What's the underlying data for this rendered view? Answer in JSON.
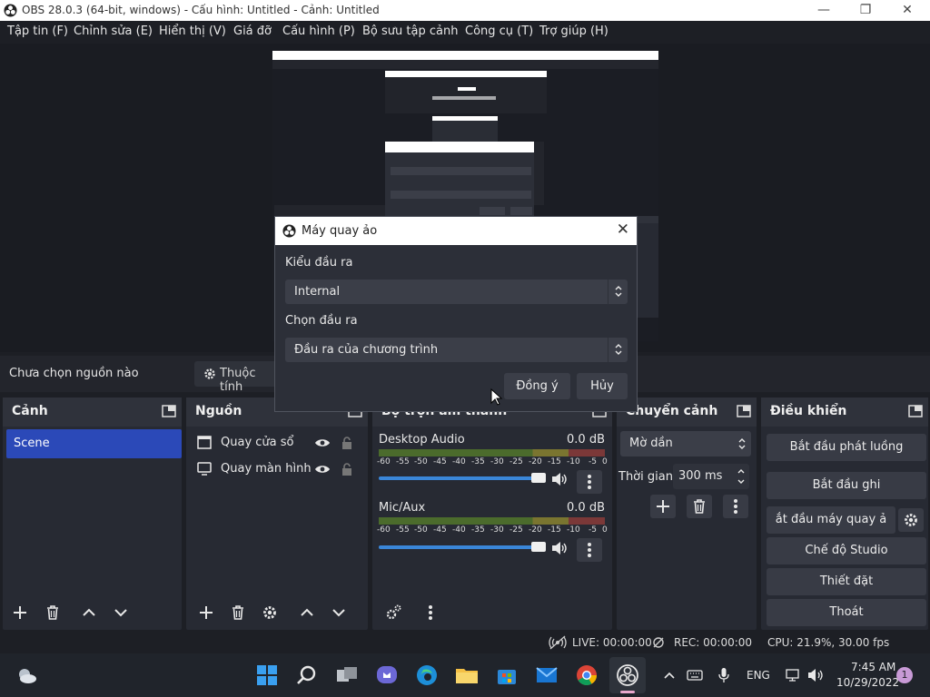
{
  "window": {
    "title": "OBS 28.0.3 (64-bit, windows) - Cấu hình: Untitled - Cảnh: Untitled"
  },
  "menu": [
    "Tập tin (F)",
    "Chỉnh sửa (E)",
    "Hiển thị (V)",
    "Giá đỡ",
    "Cấu hình (P)",
    "Bộ sưu tập cảnh",
    "Công cụ (T)",
    "Trợ giúp (H)"
  ],
  "source_bar": {
    "no_source": "Chưa chọn nguồn nào",
    "properties": "Thuộc tính"
  },
  "scenes": {
    "title": "Cảnh",
    "items": [
      "Scene"
    ]
  },
  "sources": {
    "title": "Nguồn",
    "items": [
      "Quay cửa sổ",
      "Quay màn hình"
    ]
  },
  "mixer": {
    "title": "Bộ trộn âm thanh",
    "channels": [
      {
        "name": "Desktop Audio",
        "level": "0.0 dB"
      },
      {
        "name": "Mic/Aux",
        "level": "0.0 dB"
      }
    ],
    "scale": [
      "-60",
      "-55",
      "-50",
      "-45",
      "-40",
      "-35",
      "-30",
      "-25",
      "-20",
      "-15",
      "-10",
      "-5",
      "0"
    ]
  },
  "transitions": {
    "title": "Chuyển cảnh",
    "type": "Mờ dần",
    "duration_label": "Thời gian",
    "duration": "300 ms"
  },
  "controls": {
    "title": "Điều khiển",
    "start_stream": "Bắt đầu phát luồng",
    "start_record": "Bắt đầu ghi",
    "start_vcam": "ắt đầu máy quay ả",
    "studio_mode": "Chế độ Studio",
    "settings": "Thiết đặt",
    "exit": "Thoát"
  },
  "status": {
    "live": "LIVE: 00:00:00",
    "rec": "REC: 00:00:00",
    "cpu": "CPU: 21.9%, 30.00 fps"
  },
  "dialog": {
    "title": "Máy quay ảo",
    "output_type_label": "Kiểu đầu ra",
    "output_type": "Internal",
    "output_select_label": "Chọn đầu ra",
    "output_select": "Đầu ra của chương trình",
    "ok": "Đồng ý",
    "cancel": "Hủy"
  },
  "taskbar": {
    "lang": "ENG",
    "time": "7:45 AM",
    "date": "10/29/2022",
    "badge": "1"
  },
  "colors": {
    "accent": "#2b49b8",
    "slider": "#3a86d8"
  }
}
